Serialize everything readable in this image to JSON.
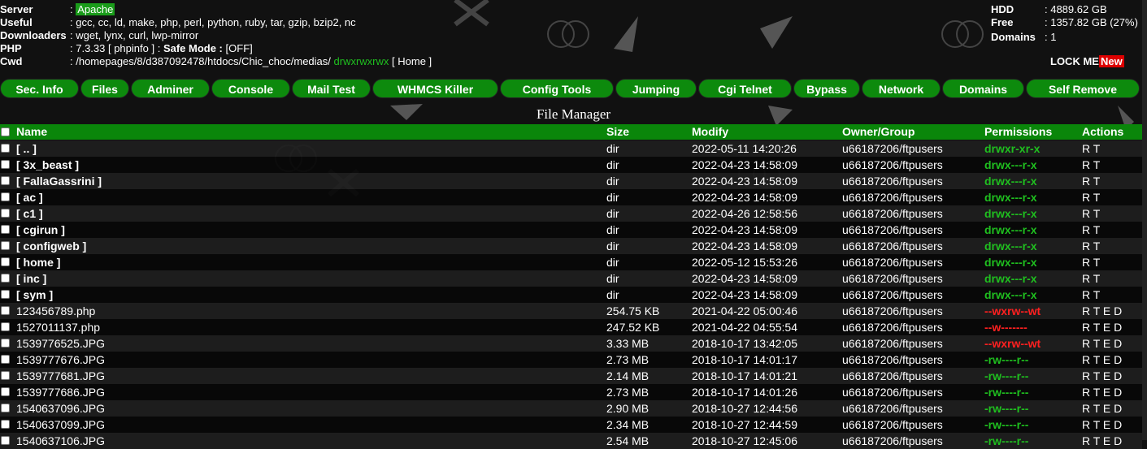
{
  "info": {
    "server_label": "Server",
    "server_value": "Apache",
    "useful_label": "Useful",
    "useful_value": ": gcc, cc, ld, make, php, perl, python, ruby, tar, gzip, bzip2, nc",
    "downloaders_label": "Downloaders",
    "downloaders_value": ": wget, lynx, curl, lwp-mirror",
    "php_label": "PHP",
    "php_value": ": 7.3.33 [ phpinfo ] :",
    "safe_mode_label": "Safe Mode :",
    "safe_mode_value": "[OFF]",
    "cwd_label": "Cwd",
    "cwd_value": ": /homepages/8/d387092478/htdocs/Chic_choc/medias/",
    "cwd_perm": "drwxrwxrwx",
    "cwd_home": "[ Home ]",
    "hdd_label": "HDD",
    "hdd_value": ": 4889.62 GB",
    "free_label": "Free",
    "free_value": ": 1357.82 GB (27%)",
    "domains_label": "Domains",
    "domains_value": ": 1",
    "lock_label": "LOCK ME",
    "new_label": "New"
  },
  "nav": [
    "Sec. Info",
    "Files",
    "Adminer",
    "Console",
    "Mail Test",
    "WHMCS Killer",
    "Config Tools",
    "Jumping",
    "Cgi Telnet",
    "Bypass",
    "Network",
    "Domains",
    "Self Remove"
  ],
  "file_manager_title": "File Manager",
  "columns": {
    "name": "Name",
    "size": "Size",
    "modify": "Modify",
    "owner": "Owner/Group",
    "permissions": "Permissions",
    "actions": "Actions"
  },
  "files": [
    {
      "name": "[ .. ]",
      "size": "dir",
      "modify": "2022-05-11 14:20:26",
      "owner": "u66187206/ftpusers",
      "perm": "drwxr-xr-x",
      "actions": "R T"
    },
    {
      "name": "[ 3x_beast ]",
      "size": "dir",
      "modify": "2022-04-23 14:58:09",
      "owner": "u66187206/ftpusers",
      "perm": "drwx---r-x",
      "actions": "R T"
    },
    {
      "name": "[ FallaGassrini ]",
      "size": "dir",
      "modify": "2022-04-23 14:58:09",
      "owner": "u66187206/ftpusers",
      "perm": "drwx---r-x",
      "actions": "R T"
    },
    {
      "name": "[ ac ]",
      "size": "dir",
      "modify": "2022-04-23 14:58:09",
      "owner": "u66187206/ftpusers",
      "perm": "drwx---r-x",
      "actions": "R T"
    },
    {
      "name": "[ c1 ]",
      "size": "dir",
      "modify": "2022-04-26 12:58:56",
      "owner": "u66187206/ftpusers",
      "perm": "drwx---r-x",
      "actions": "R T"
    },
    {
      "name": "[ cgirun ]",
      "size": "dir",
      "modify": "2022-04-23 14:58:09",
      "owner": "u66187206/ftpusers",
      "perm": "drwx---r-x",
      "actions": "R T"
    },
    {
      "name": "[ configweb ]",
      "size": "dir",
      "modify": "2022-04-23 14:58:09",
      "owner": "u66187206/ftpusers",
      "perm": "drwx---r-x",
      "actions": "R T"
    },
    {
      "name": "[ home ]",
      "size": "dir",
      "modify": "2022-05-12 15:53:26",
      "owner": "u66187206/ftpusers",
      "perm": "drwx---r-x",
      "actions": "R T"
    },
    {
      "name": "[ inc ]",
      "size": "dir",
      "modify": "2022-04-23 14:58:09",
      "owner": "u66187206/ftpusers",
      "perm": "drwx---r-x",
      "actions": "R T"
    },
    {
      "name": "[ sym ]",
      "size": "dir",
      "modify": "2022-04-23 14:58:09",
      "owner": "u66187206/ftpusers",
      "perm": "drwx---r-x",
      "actions": "R T"
    },
    {
      "name": "123456789.php",
      "size": "254.75 KB",
      "modify": "2021-04-22 05:00:46",
      "owner": "u66187206/ftpusers",
      "perm": "--wxrw--wt",
      "actions": "R T E D"
    },
    {
      "name": "1527011137.php",
      "size": "247.52 KB",
      "modify": "2021-04-22 04:55:54",
      "owner": "u66187206/ftpusers",
      "perm": "--w-------",
      "actions": "R T E D"
    },
    {
      "name": "1539776525.JPG",
      "size": "3.33 MB",
      "modify": "2018-10-17 13:42:05",
      "owner": "u66187206/ftpusers",
      "perm": "--wxrw--wt",
      "actions": "R T E D"
    },
    {
      "name": "1539777676.JPG",
      "size": "2.73 MB",
      "modify": "2018-10-17 14:01:17",
      "owner": "u66187206/ftpusers",
      "perm": "-rw----r--",
      "actions": "R T E D"
    },
    {
      "name": "1539777681.JPG",
      "size": "2.14 MB",
      "modify": "2018-10-17 14:01:21",
      "owner": "u66187206/ftpusers",
      "perm": "-rw----r--",
      "actions": "R T E D"
    },
    {
      "name": "1539777686.JPG",
      "size": "2.73 MB",
      "modify": "2018-10-17 14:01:26",
      "owner": "u66187206/ftpusers",
      "perm": "-rw----r--",
      "actions": "R T E D"
    },
    {
      "name": "1540637096.JPG",
      "size": "2.90 MB",
      "modify": "2018-10-27 12:44:56",
      "owner": "u66187206/ftpusers",
      "perm": "-rw----r--",
      "actions": "R T E D"
    },
    {
      "name": "1540637099.JPG",
      "size": "2.34 MB",
      "modify": "2018-10-27 12:44:59",
      "owner": "u66187206/ftpusers",
      "perm": "-rw----r--",
      "actions": "R T E D"
    },
    {
      "name": "1540637106.JPG",
      "size": "2.54 MB",
      "modify": "2018-10-27 12:45:06",
      "owner": "u66187206/ftpusers",
      "perm": "-rw----r--",
      "actions": "R T E D"
    }
  ],
  "colors": {
    "green": "#0a860a",
    "perm_green": "#1fbf1f",
    "perm_red": "#ff2020"
  }
}
